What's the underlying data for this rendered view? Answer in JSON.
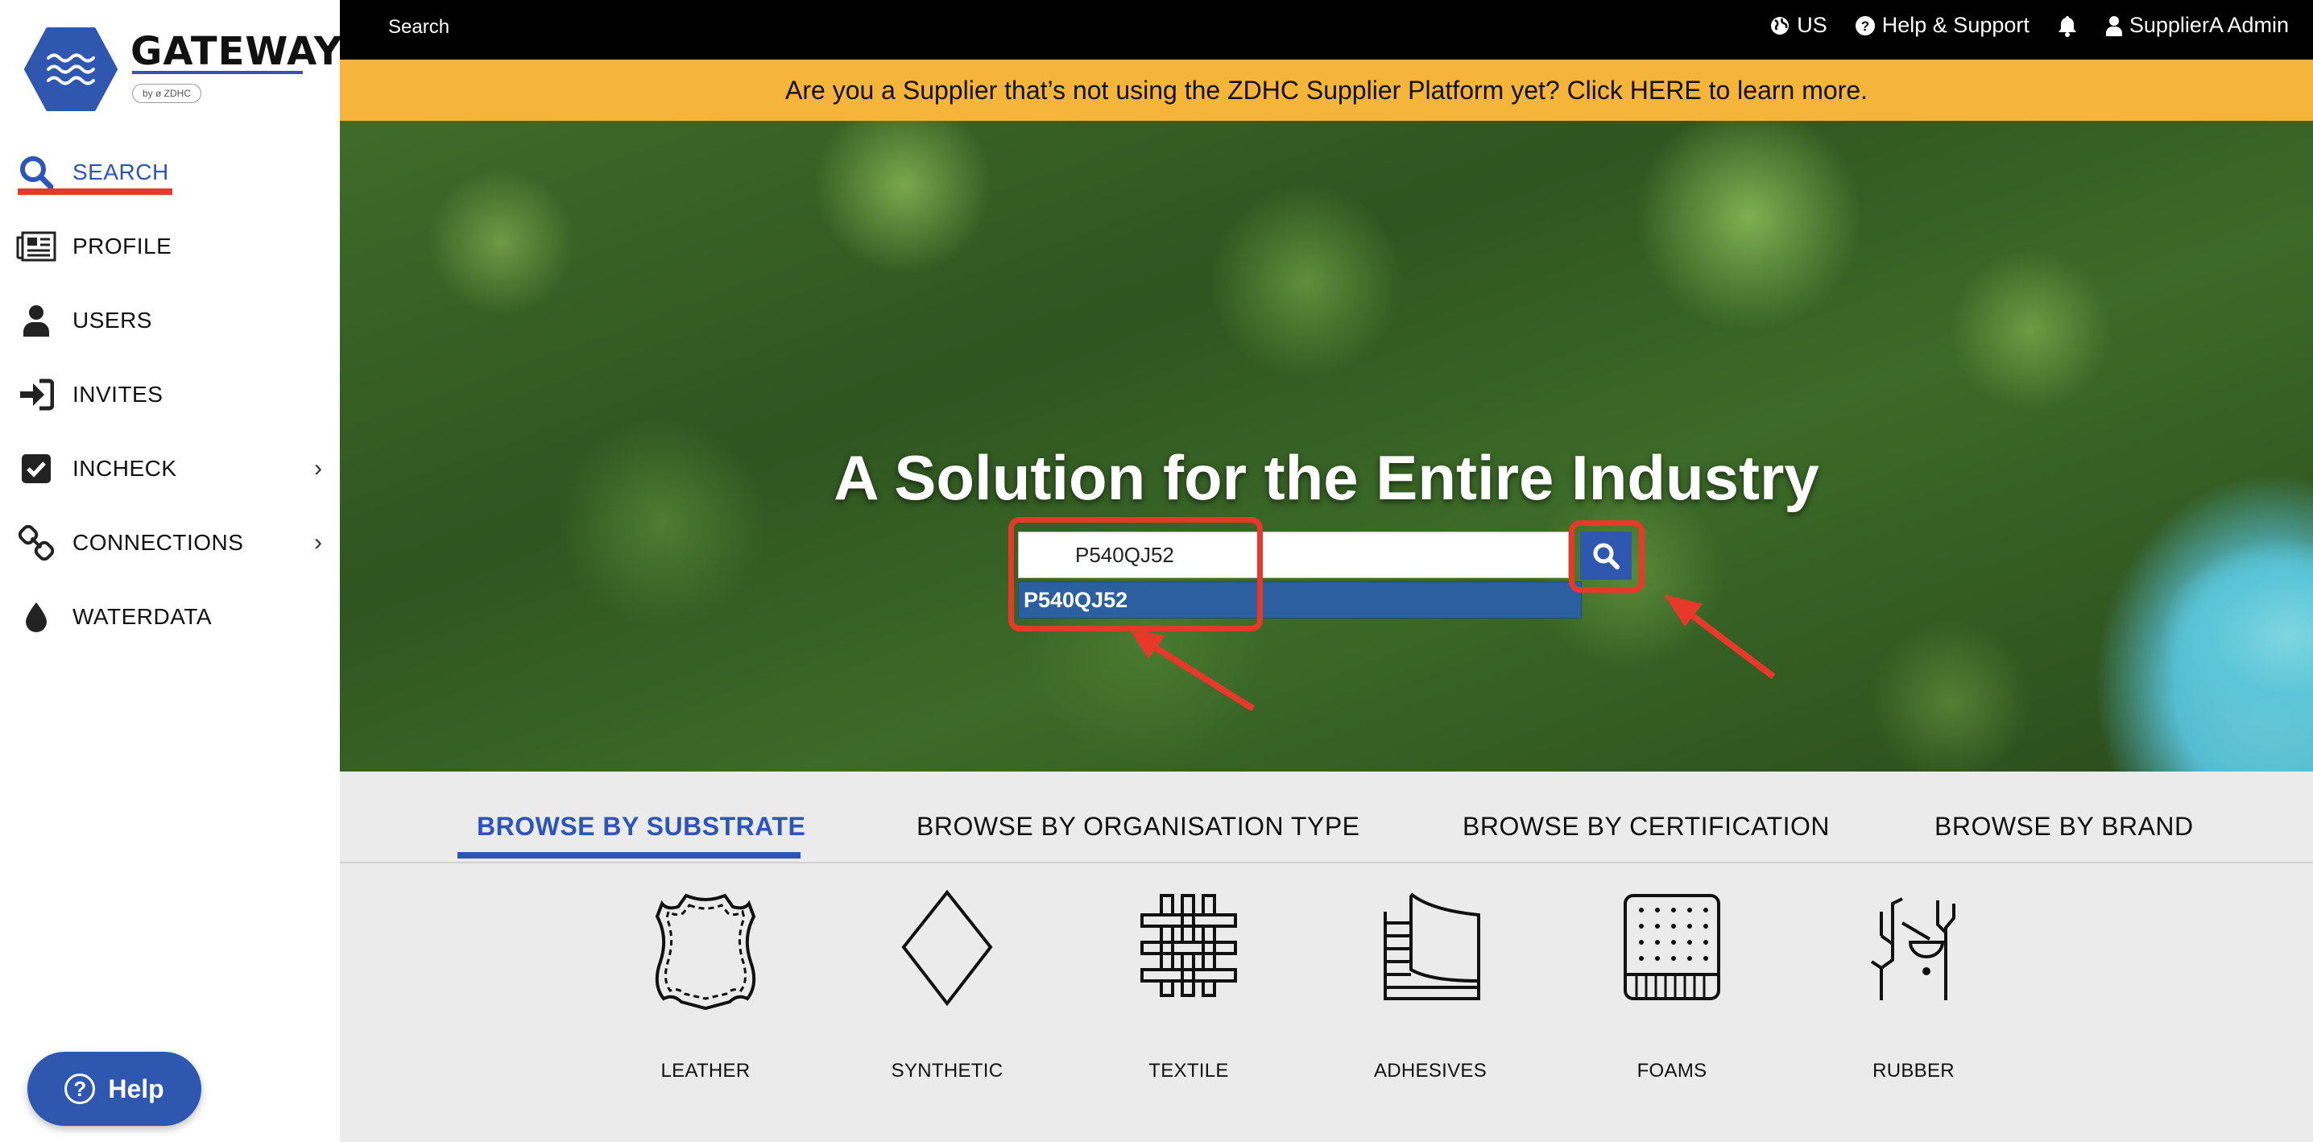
{
  "brand": {
    "name": "GATEWAY",
    "tagline": "by ø ZDHC"
  },
  "sidebar": {
    "items": [
      {
        "label": "SEARCH",
        "icon": "search-icon",
        "active": true
      },
      {
        "label": "PROFILE",
        "icon": "newspaper-icon"
      },
      {
        "label": "USERS",
        "icon": "user-icon"
      },
      {
        "label": "INVITES",
        "icon": "sign-in-icon"
      },
      {
        "label": "INCHECK",
        "icon": "checkbox-icon",
        "expandable": true
      },
      {
        "label": "CONNECTIONS",
        "icon": "link-icon",
        "expandable": true
      },
      {
        "label": "WATERDATA",
        "icon": "droplet-icon"
      }
    ],
    "help_label": "Help"
  },
  "topbar": {
    "title": "Search",
    "region": "US",
    "help_support": "Help & Support",
    "user": "SupplierA Admin"
  },
  "banner": {
    "text": "Are you a Supplier that’s not using the ZDHC Supplier Platform yet? Click HERE to learn more."
  },
  "hero": {
    "title": "A Solution for the Entire Industry",
    "search_value": "P540QJ52",
    "suggestion": "P540QJ52"
  },
  "browse": {
    "tabs": [
      {
        "label": "BROWSE BY SUBSTRATE",
        "active": true
      },
      {
        "label": "BROWSE BY ORGANISATION TYPE"
      },
      {
        "label": "BROWSE BY CERTIFICATION"
      },
      {
        "label": "BROWSE BY BRAND"
      }
    ],
    "substrates": [
      {
        "label": "LEATHER",
        "icon": "leather-icon"
      },
      {
        "label": "SYNTHETIC",
        "icon": "diamond-icon"
      },
      {
        "label": "TEXTILE",
        "icon": "weave-icon"
      },
      {
        "label": "ADHESIVES",
        "icon": "adhesive-icon"
      },
      {
        "label": "FOAMS",
        "icon": "foam-icon"
      },
      {
        "label": "RUBBER",
        "icon": "rubber-tap-icon"
      }
    ]
  },
  "colors": {
    "accent": "#2d54b7",
    "highlight": "#e53a2a",
    "banner": "#f5b43a",
    "topbar": "#000000"
  }
}
